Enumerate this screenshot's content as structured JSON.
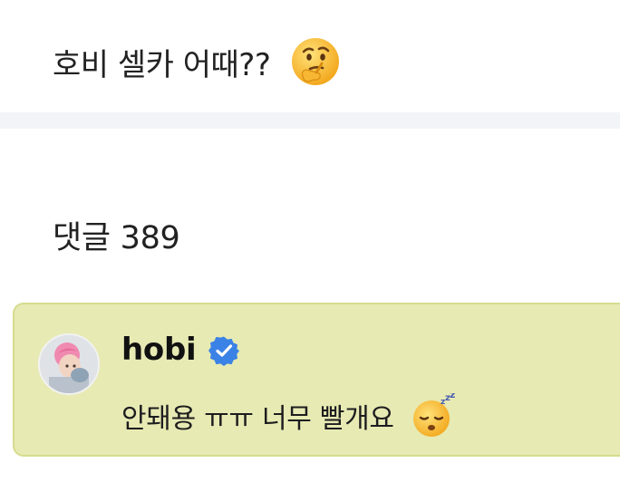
{
  "post": {
    "title": "호비 셀카 어때??",
    "title_emoji": "thinking-face-emoji"
  },
  "comments": {
    "header": "댓글 389",
    "items": [
      {
        "author": "hobi",
        "verified": true,
        "text": "안돼용 ㅠㅠ 너무 빨개요",
        "emoji": "sleeping-face-emoji",
        "highlight_color": "#e7eab3"
      }
    ]
  },
  "colors": {
    "highlight": "#e7eab3",
    "highlight_border": "#d6dc8e",
    "divider": "#f3f4f8",
    "verified_badge": "#3b82e6"
  }
}
